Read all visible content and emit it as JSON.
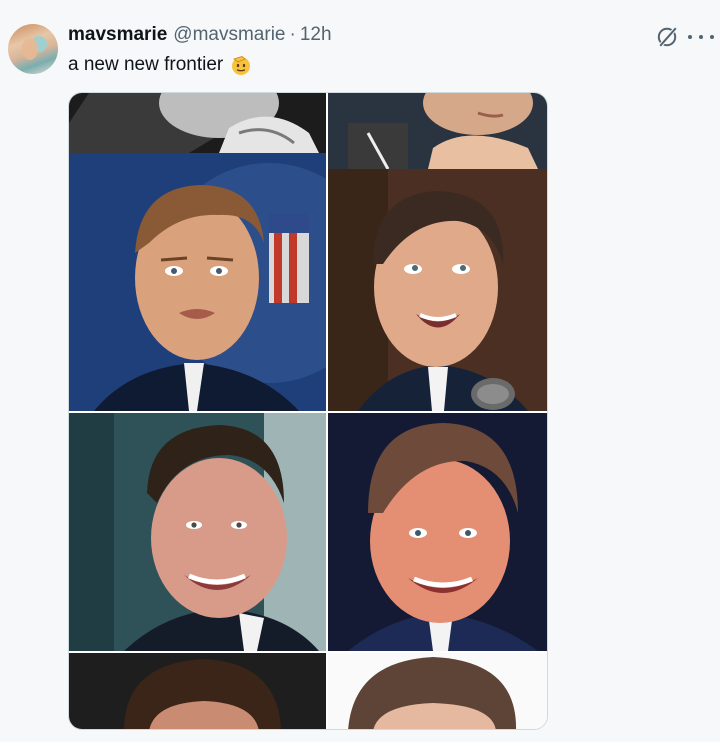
{
  "author": {
    "display_name": "mavsmarie",
    "handle": "@mavsmarie",
    "separator": "·",
    "time": "12h"
  },
  "tweet": {
    "text": "a new new frontier",
    "emoji": "saluting-face-emoji"
  },
  "icons": {
    "grok": "grok-slash-icon",
    "more": "more-options-icon"
  },
  "media": {
    "type": "photo-collage",
    "rows": 4,
    "columns": 2
  },
  "colors": {
    "background": "#f7f8f9",
    "text_primary": "#0f1419",
    "text_secondary": "#536471",
    "border": "#cfd9de"
  }
}
